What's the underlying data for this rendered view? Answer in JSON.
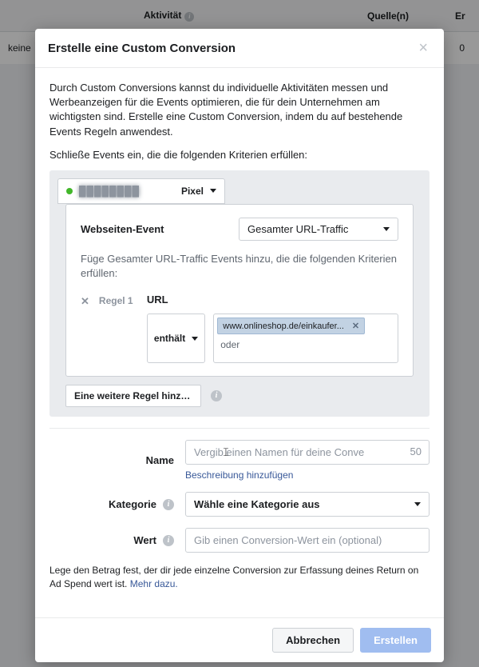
{
  "bg": {
    "cols": {
      "c2": "Aktivität",
      "c3": "Quelle(n)",
      "c4": "Er"
    },
    "row": {
      "left": "keine",
      "right": "0"
    }
  },
  "modal": {
    "title": "Erstelle eine Custom Conversion",
    "intro": "Durch Custom Conversions kannst du individuelle Aktivitäten messen und Werbeanzeigen für die Events optimieren, die für dein Unternehmen am wichtigsten sind. Erstelle eine Custom Conversion, indem du auf bestehende Events Regeln anwendest.",
    "criteria_line": "Schließe Events ein, die die folgenden Kriterien erfüllen:",
    "pixel_suffix": "Pixel",
    "website_event_label": "Webseiten-Event",
    "website_event_value": "Gesamter URL-Traffic",
    "subtext": "Füge Gesamter URL-Traffic Events hinzu, die die folgenden Kriterien erfüllen:",
    "rule_label": "Regel 1",
    "url_label": "URL",
    "contains_label": "enthält",
    "url_chip": "www.onlineshop.de/einkaufer...",
    "oder": "oder",
    "add_rule": "Eine weitere Regel hinzuf...",
    "name_label": "Name",
    "name_placeholder": "Vergib einen Namen für deine Conve",
    "name_count": "50",
    "desc_link": "Beschreibung hinzufügen",
    "category_label": "Kategorie",
    "category_value": "Wähle eine Kategorie aus",
    "wert_label": "Wert",
    "wert_placeholder": "Gib einen Conversion-Wert ein (optional)",
    "footnote_text": "Lege den Betrag fest, der dir jede einzelne Conversion zur Erfassung deines Return on Ad Spend wert ist. ",
    "footnote_link": "Mehr dazu.",
    "cancel": "Abbrechen",
    "create": "Erstellen"
  }
}
